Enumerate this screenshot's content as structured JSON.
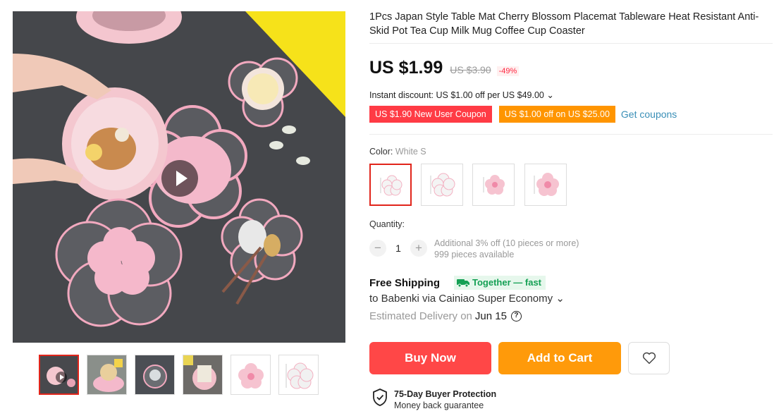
{
  "product": {
    "title": "1Pcs Japan Style Table Mat Cherry Blossom Placemat Tableware Heat Resistant Anti-Skid Pot Tea Cup Milk Mug Coffee Cup Coaster"
  },
  "price": {
    "current": "US $1.99",
    "original": "US $3.90",
    "discount": "-49%"
  },
  "instant_discount": "Instant discount: US $1.00 off per US $49.00 ⌄",
  "coupons": {
    "new_user": "US $1.90 New User Coupon",
    "threshold": "US $1.00 off on US $25.00",
    "get_link": "Get coupons"
  },
  "color": {
    "label": "Color:",
    "selected": "White S",
    "options": [
      "White S",
      "White L",
      "Pink S",
      "Pink L"
    ]
  },
  "quantity": {
    "label": "Quantity:",
    "value": "1",
    "minus": "−",
    "plus": "+",
    "additional": "Additional 3% off (10 pieces or more)",
    "available": "999 pieces available"
  },
  "shipping": {
    "title": "Free Shipping",
    "badge": "Together — fast",
    "to": "to Babenki via Cainiao Super Economy ⌄",
    "estimated_label": "Estimated Delivery on",
    "estimated_date": "Jun 15",
    "help": "?"
  },
  "actions": {
    "buy_now": "Buy Now",
    "add_to_cart": "Add to Cart"
  },
  "protection": {
    "title": "75-Day Buyer Protection",
    "subtitle": "Money back guarantee"
  },
  "colors": {
    "accent_red": "#ff4747",
    "accent_orange": "#ff9a0a",
    "coupon_red": "#ff3b45",
    "coupon_orange": "#ff9500",
    "link_blue": "#3a8fb7",
    "shipping_green": "#14a054"
  },
  "icons": {
    "play": "play-icon",
    "heart": "heart-icon",
    "shield": "shield-check-icon",
    "truck": "truck-icon",
    "help": "question-circle-icon"
  }
}
